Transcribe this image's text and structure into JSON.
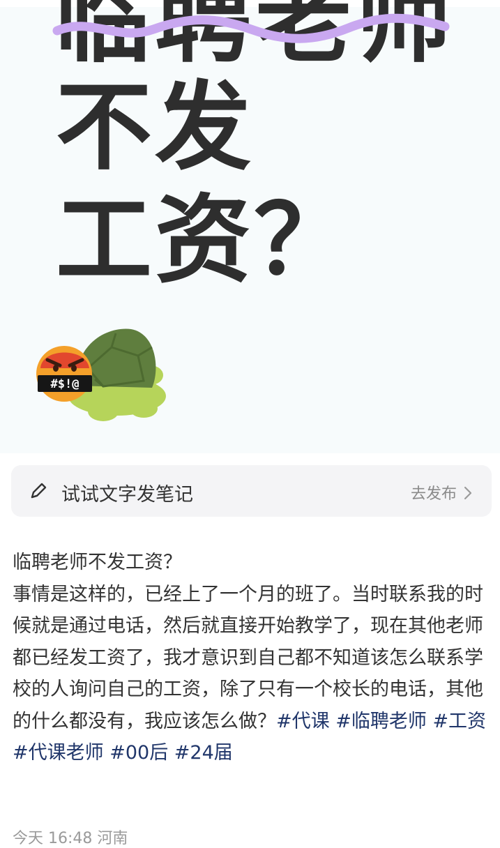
{
  "cover": {
    "title_line1": "临聘老师",
    "title_line2": "不发",
    "title_line3": "工资？",
    "sticker_text": "#$!@",
    "squiggle_color": "#c9a8f0",
    "text_color": "#2e2e2e"
  },
  "prompt_bar": {
    "label": "试试文字发笔记",
    "action_label": "去发布"
  },
  "note": {
    "title": "临聘老师不发工资？",
    "body": "事情是这样的，已经上了一个月的班了。当时联系我的时候就是通过电话，然后就直接开始教学了，现在其他老师都已经发工资了，我才意识到自己都不知道该怎么联系学校的人询问自己的工资，除了只有一个校长的电话，其他的什么都没有，我应该怎么做？",
    "tags": [
      "#代课",
      "#临聘老师",
      "#工资",
      "#代课老师",
      "#00后",
      "#24届"
    ],
    "tag_color": "#20366a"
  },
  "meta": {
    "time_location": "今天 16:48 河南"
  }
}
